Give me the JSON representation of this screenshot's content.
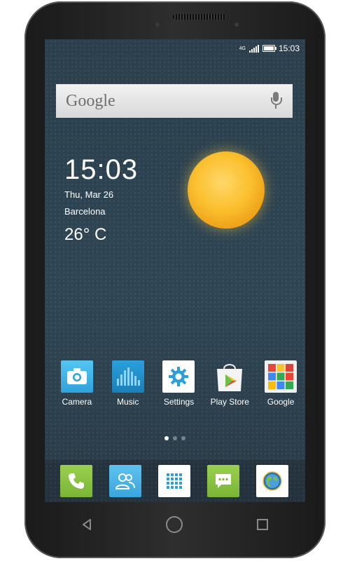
{
  "status_bar": {
    "time": "15:03",
    "network": "4G"
  },
  "search_widget": {
    "logo_text": "Google"
  },
  "clock_widget": {
    "time": "15:03",
    "date": "Thu, Mar 26",
    "city": "Barcelona",
    "temperature": "26° C"
  },
  "apps": [
    {
      "label": "Camera",
      "icon": "camera-icon"
    },
    {
      "label": "Music",
      "icon": "music-icon"
    },
    {
      "label": "Settings",
      "icon": "settings-gear-icon"
    },
    {
      "label": "Play Store",
      "icon": "play-store-icon"
    },
    {
      "label": "Google",
      "icon": "google-apps-folder-icon"
    }
  ],
  "page_indicator": {
    "pages": 3,
    "current": 1
  },
  "dock": [
    {
      "icon": "phone-icon"
    },
    {
      "icon": "contacts-icon"
    },
    {
      "icon": "app-drawer-icon"
    },
    {
      "icon": "messaging-icon"
    },
    {
      "icon": "browser-globe-icon"
    }
  ],
  "colors": {
    "wallpaper": "#2f4554",
    "camera": "#3fb3e8",
    "music": "#1e8fc9",
    "phone": "#8bc53f",
    "contacts": "#4cb2e4",
    "messaging": "#8bc53f"
  }
}
